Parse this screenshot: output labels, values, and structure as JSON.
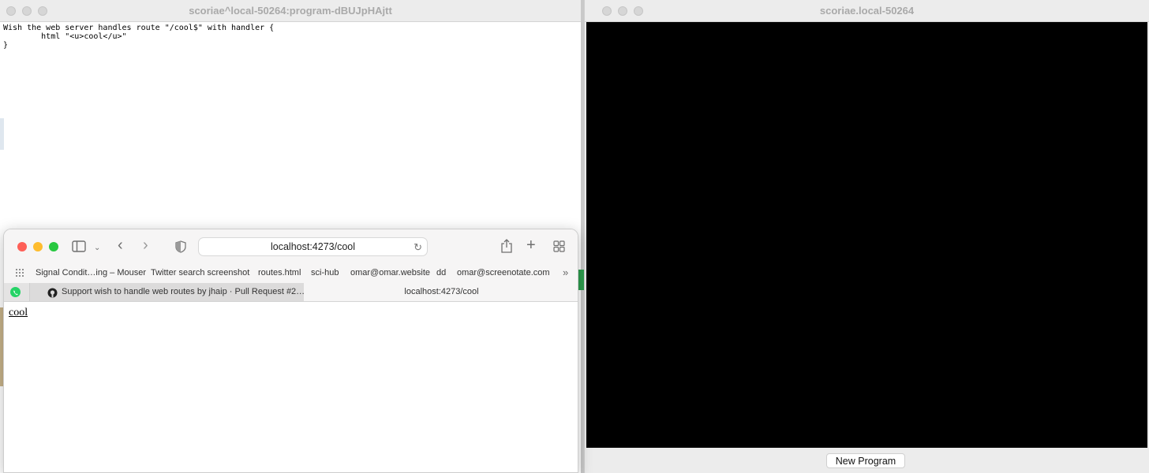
{
  "editor": {
    "title": "scoriae^local-50264:program-dBUJpHAjtt",
    "code": "Wish the web server handles route \"/cool$\" with handler {\n        html \"<u>cool</u>\"\n}"
  },
  "program": {
    "title": "scoriae.local-50264",
    "new_program_label": "New Program"
  },
  "safari": {
    "url": "localhost:4273/cool",
    "bookmarks": [
      "Signal Condit…ing – Mouser",
      "Twitter search screenshot",
      "routes.html",
      "sci-hub",
      "omar@omar.website",
      "dd",
      "omar@screenotate.com"
    ],
    "tabs": [
      {
        "label": "Support wish to handle web routes by jhaip · Pull Request #2…",
        "active": false
      },
      {
        "label": "localhost:4273/cool",
        "active": true
      }
    ],
    "page_text": "cool"
  },
  "colors": {
    "close": "#fe5f57",
    "minimize": "#febc2e",
    "zoom": "#28c840",
    "whatsapp": "#25d366"
  },
  "icons": [
    "sidebar-icon",
    "chevron-down-icon",
    "back-icon",
    "forward-icon",
    "shield-icon",
    "reload-icon",
    "share-icon",
    "new-tab-icon",
    "tab-overview-icon",
    "grid-icon",
    "more-chevron-icon",
    "whatsapp-icon",
    "github-icon"
  ]
}
